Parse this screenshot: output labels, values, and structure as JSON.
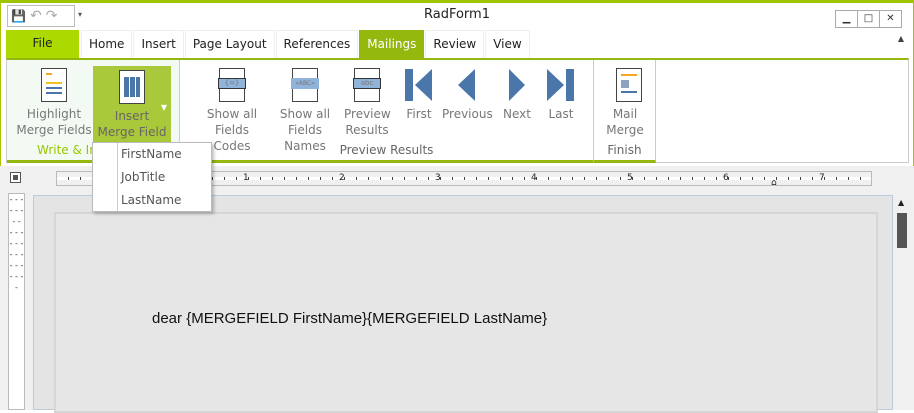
{
  "window": {
    "title": "RadForm1",
    "minimize": "▁",
    "maximize": "□",
    "close": "✕"
  },
  "qat": {
    "save": "💾",
    "undo": "↶",
    "redo": "↷",
    "customize": "▾"
  },
  "tabs": [
    "File",
    "Home",
    "Insert",
    "Page Layout",
    "References",
    "Mailings",
    "Review",
    "View"
  ],
  "selected_tab": "Mailings",
  "ribbon": {
    "groups": [
      {
        "label": "Write & In"
      },
      {
        "label": "Preview Results"
      },
      {
        "label": "Finish"
      }
    ],
    "buttons": {
      "highlight": [
        "Highlight",
        "Merge Fields"
      ],
      "insert": [
        "Insert",
        "Merge  Field"
      ],
      "show_codes": [
        "Show all",
        "Fields Codes"
      ],
      "show_names": [
        "Show all",
        "Fields Names"
      ],
      "preview": [
        "Preview",
        "Results"
      ],
      "first": "First",
      "previous": "Previous",
      "next": "Next",
      "last": "Last",
      "mail_merge": [
        "Mail",
        "Merge"
      ]
    },
    "icon_labels": {
      "codes": "{=}",
      "names": "«ABC»",
      "preview": "abc"
    }
  },
  "dropdown": {
    "items": [
      "FirstName",
      "JobTitle",
      "LastName"
    ]
  },
  "ruler": {
    "numbers": [
      "1",
      "2",
      "3",
      "4",
      "5",
      "6",
      "7"
    ]
  },
  "document": {
    "text": "dear {MERGEFIELD FirstName}{MERGEFIELD LastName}"
  },
  "colors": {
    "accent": "#95b80f",
    "file_tab": "#acd900",
    "icon_blue": "#4a76aa"
  }
}
